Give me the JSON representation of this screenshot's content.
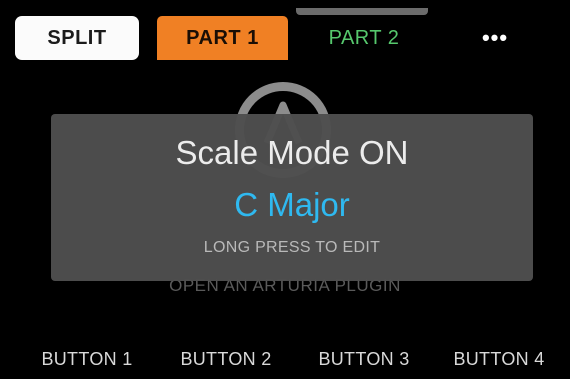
{
  "tabs": {
    "split": "SPLIT",
    "part1": "PART 1",
    "part2": "PART 2",
    "more": "•••"
  },
  "background": {
    "caption": "OPEN AN ARTURIA PLUGIN",
    "logo_icon": "arturia-logo-icon"
  },
  "popup": {
    "title": "Scale Mode ON",
    "value": "C Major",
    "hint": "LONG PRESS TO EDIT"
  },
  "buttons": [
    "BUTTON 1",
    "BUTTON 2",
    "BUTTON 3",
    "BUTTON 4"
  ],
  "colors": {
    "background": "#000000",
    "split_tab": "#fbfbfb",
    "part1_tab": "#f08024",
    "part2_text": "#56c86d",
    "popup_bg": "#4e4e4e",
    "scale_value": "#2fb9f0"
  }
}
